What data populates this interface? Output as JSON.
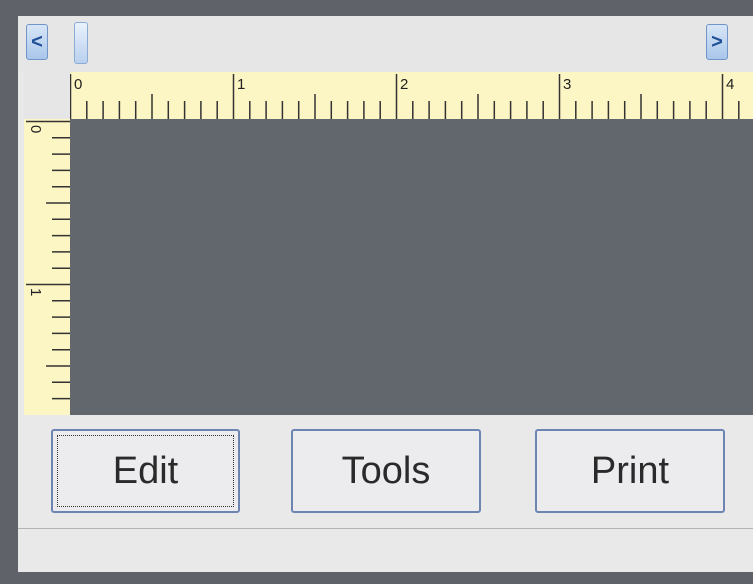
{
  "scrollbar": {
    "left_arrow": "<",
    "right_arrow": ">"
  },
  "horizontal_ruler": {
    "labels": [
      "0",
      "1",
      "2",
      "3",
      "4"
    ]
  },
  "vertical_ruler": {
    "labels": [
      "0",
      "1"
    ]
  },
  "buttons": {
    "edit": "Edit",
    "tools": "Tools",
    "print": "Print"
  },
  "colors": {
    "ruler_background": "#fcf6c4",
    "canvas_background": "#62666d",
    "button_border": "#6e85b4"
  }
}
